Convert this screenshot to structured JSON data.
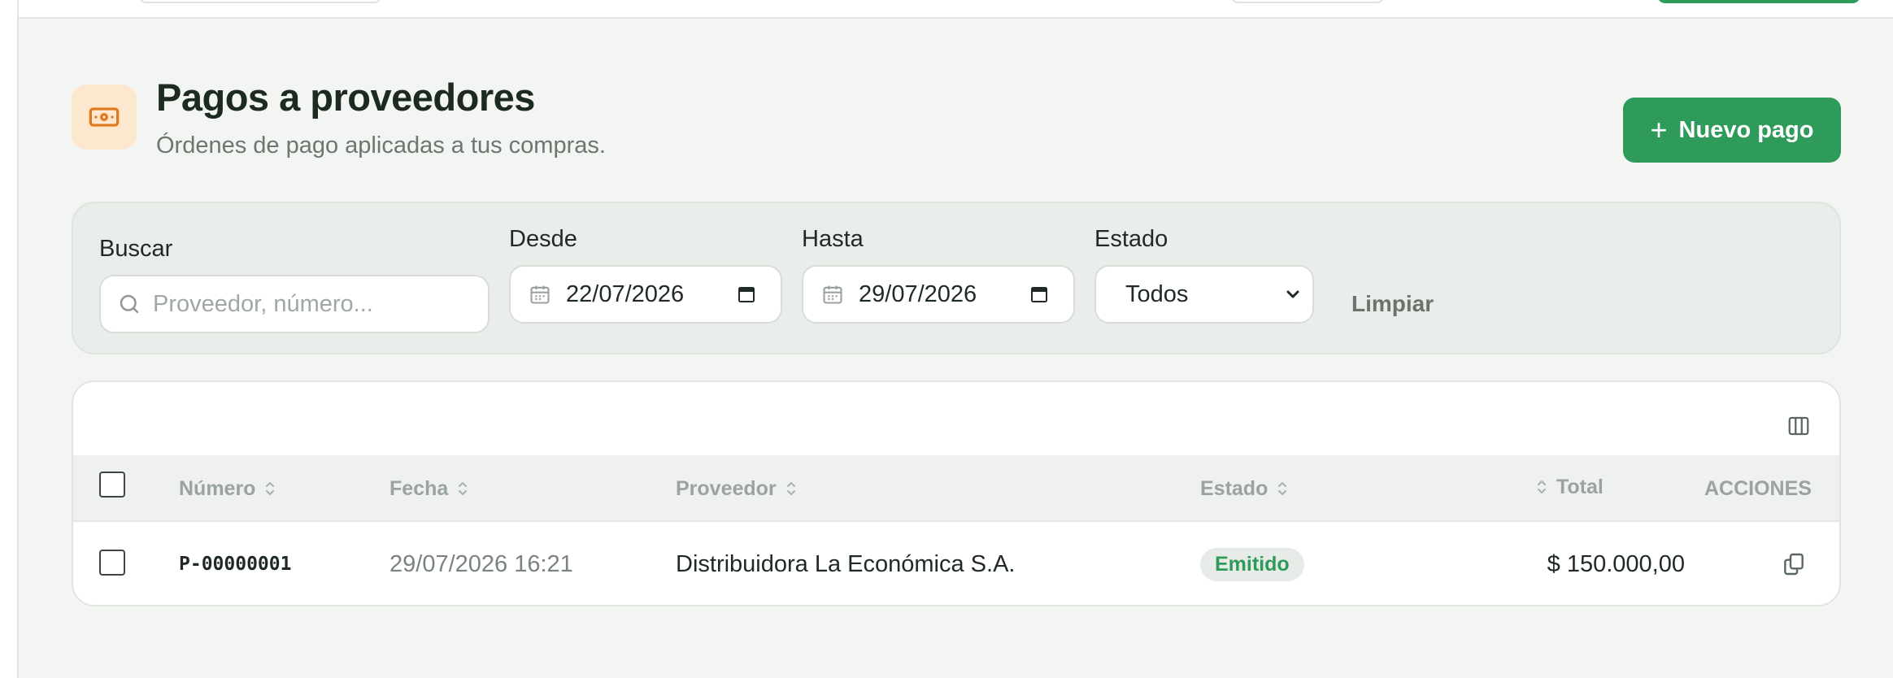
{
  "header": {
    "title": "Pagos a proveedores",
    "subtitle": "Órdenes de pago aplicadas a tus compras.",
    "icon": "cash-icon",
    "new_button_label": "Nuevo pago"
  },
  "filters": {
    "search_label": "Buscar",
    "search_placeholder": "Proveedor, número...",
    "from_label": "Desde",
    "from_value": "22/07/2026",
    "to_label": "Hasta",
    "to_value": "29/07/2026",
    "status_label": "Estado",
    "status_value": "Todos",
    "clear_label": "Limpiar"
  },
  "table": {
    "columns": {
      "number": "Número",
      "date": "Fecha",
      "supplier": "Proveedor",
      "status": "Estado",
      "total": "Total",
      "actions": "ACCIONES"
    },
    "rows": [
      {
        "number": "P-00000001",
        "date": "29/07/2026 16:21",
        "supplier": "Distribuidora La Económica S.A.",
        "status": "Emitido",
        "total": "$ 150.000,00"
      }
    ]
  },
  "colors": {
    "accent": "#2e9b5b",
    "icon_bg": "#fbe8cf",
    "icon_fg": "#e07a1f"
  }
}
